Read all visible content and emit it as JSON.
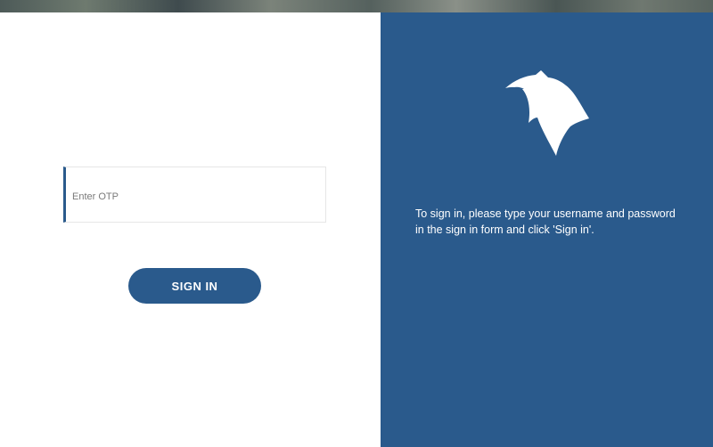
{
  "form": {
    "otp_placeholder": "Enter OTP",
    "otp_value": "",
    "signin_label": "SIGN IN"
  },
  "info": {
    "logo_icon": "eagle-head-icon",
    "instructions": "To sign in, please type your username and password in the sign in form and click 'Sign in'."
  },
  "colors": {
    "brand_blue": "#2a5a8c",
    "background": "#ffffff",
    "text_on_brand": "#ffffff"
  }
}
